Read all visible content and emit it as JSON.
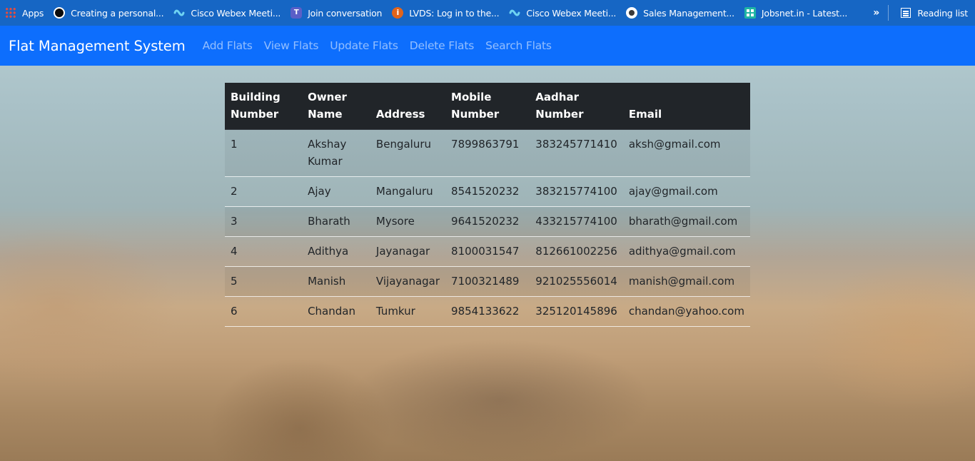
{
  "bookmarks_bar": {
    "items": [
      {
        "label": "Apps",
        "icon": "apps-grid-icon"
      },
      {
        "label": "Creating a personal...",
        "icon": "github-icon"
      },
      {
        "label": "Cisco Webex Meeti...",
        "icon": "webex-icon"
      },
      {
        "label": "Join conversation",
        "icon": "teams-icon"
      },
      {
        "label": "LVDS: Log in to the...",
        "icon": "lvds-icon"
      },
      {
        "label": "Cisco Webex Meeti...",
        "icon": "webex-icon"
      },
      {
        "label": "Sales Management...",
        "icon": "globe-icon"
      },
      {
        "label": "Jobsnet.in - Latest...",
        "icon": "jobsnet-icon"
      }
    ],
    "overflow_label": "»",
    "reading_list_label": "Reading list"
  },
  "navbar": {
    "brand": "Flat Management System",
    "links": [
      "Add Flats",
      "View Flats",
      "Update Flats",
      "Delete Flats",
      "Search Flats"
    ]
  },
  "table": {
    "headers": [
      "Building Number",
      "Owner Name",
      "Address",
      "Mobile Number",
      "Aadhar Number",
      "Email"
    ],
    "rows": [
      [
        "1",
        "Akshay Kumar",
        "Bengaluru",
        "7899863791",
        "383245771410",
        "aksh@gmail.com"
      ],
      [
        "2",
        "Ajay",
        "Mangaluru",
        "8541520232",
        "383215774100",
        "ajay@gmail.com"
      ],
      [
        "3",
        "Bharath",
        "Mysore",
        "9641520232",
        "433215774100",
        "bharath@gmail.com"
      ],
      [
        "4",
        "Adithya",
        "Jayanagar",
        "8100031547",
        "812661002256",
        "adithya@gmail.com"
      ],
      [
        "5",
        "Manish",
        "Vijayanagar",
        "7100321489",
        "921025556014",
        "manish@gmail.com"
      ],
      [
        "6",
        "Chandan",
        "Tumkur",
        "9854133622",
        "325120145896",
        "chandan@yahoo.com"
      ]
    ]
  },
  "colors": {
    "bookmarks_bar_bg": "#1666c4",
    "navbar_bg": "#0d6efd",
    "table_header_bg": "#212529"
  }
}
